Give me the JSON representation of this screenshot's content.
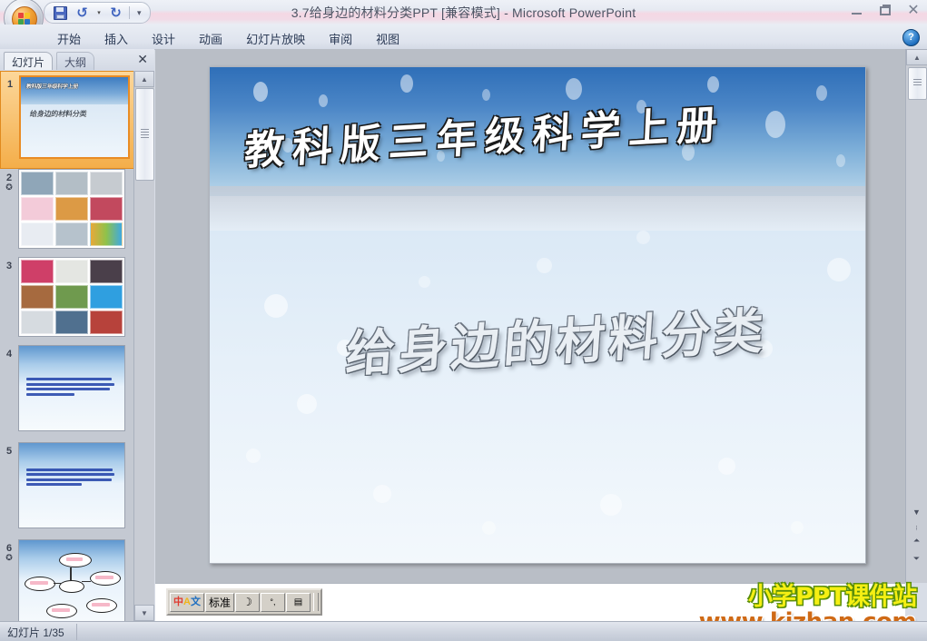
{
  "window": {
    "title": "3.7给身边的材料分类PPT [兼容模式]  -  Microsoft PowerPoint",
    "minimize_label": "",
    "restore_label": "",
    "close_label": "✕"
  },
  "quick_access": {
    "save_icon": "save-icon",
    "undo_icon": "undo-icon",
    "undo_dropdown": "▾",
    "redo_icon": "redo-icon",
    "customize_label": "▾"
  },
  "ribbon": {
    "tabs": [
      {
        "label": "开始",
        "active": false
      },
      {
        "label": "插入",
        "active": false
      },
      {
        "label": "设计",
        "active": false
      },
      {
        "label": "动画",
        "active": false
      },
      {
        "label": "幻灯片放映",
        "active": false
      },
      {
        "label": "审阅",
        "active": false
      },
      {
        "label": "视图",
        "active": false
      }
    ],
    "help_label": "?"
  },
  "left_panel": {
    "tabs": [
      {
        "label": "幻灯片",
        "active": true
      },
      {
        "label": "大纲",
        "active": false
      }
    ],
    "close_label": "✕",
    "scroll_up": "▲",
    "scroll_down": "▼",
    "thumbnails": [
      {
        "number": "1",
        "animated": false,
        "selected": true,
        "kind": "title",
        "title": "教科版三年级科学上册",
        "subtitle": "给身边的材料分类"
      },
      {
        "number": "2",
        "animated": true,
        "selected": false,
        "kind": "pictures",
        "colors": [
          "#9fb2c2",
          "#b9c4cc",
          "#c9ced2",
          "#f2c9d8",
          "#e0a04e",
          "#c4435a",
          "#e8eaf0",
          "#bcc6cf",
          "#e9a13c"
        ]
      },
      {
        "number": "3",
        "animated": false,
        "selected": false,
        "kind": "pictures",
        "colors": [
          "#d1416a",
          "#e7e7e4",
          "#4a3f4a",
          "#a96a3c",
          "#6f9a4e",
          "#2f9fe0",
          "#d8dde2",
          "#4f6f93",
          "#b9413a"
        ]
      },
      {
        "number": "4",
        "animated": false,
        "selected": false,
        "kind": "text",
        "lines": [
          88,
          92,
          86,
          55
        ]
      },
      {
        "number": "5",
        "animated": false,
        "selected": false,
        "kind": "text",
        "lines": [
          90,
          90,
          88,
          60
        ]
      },
      {
        "number": "6",
        "animated": true,
        "selected": false,
        "kind": "diagram"
      }
    ]
  },
  "slide": {
    "title": "教科版三年级科学上册",
    "subtitle": "给身边的材料分类",
    "background_sky": "#2f6fb8",
    "background_ground": "#eaf3fb"
  },
  "slide_scroll": {
    "up_arrow": "▲",
    "down_arrow": "▼",
    "prev_slide": "⏶",
    "next_slide": "⏷",
    "section_dot": "⁝"
  },
  "ime_toolbar": {
    "logo": "ime-logo-icon",
    "mode_label": "标准",
    "shape_icon": "moon-icon",
    "punctuation_icon": "punctuation-icon",
    "keyboard_icon": "keyboard-icon"
  },
  "watermark": {
    "line1": "小学PPT课件站",
    "line2": "www.kjzhan.com",
    "line1_color": "#f5ef13",
    "line1_outline": "#5a8f0a",
    "line2_color": "#cf6a16"
  },
  "status_bar": {
    "slide_counter": "幻灯片 1/35"
  }
}
